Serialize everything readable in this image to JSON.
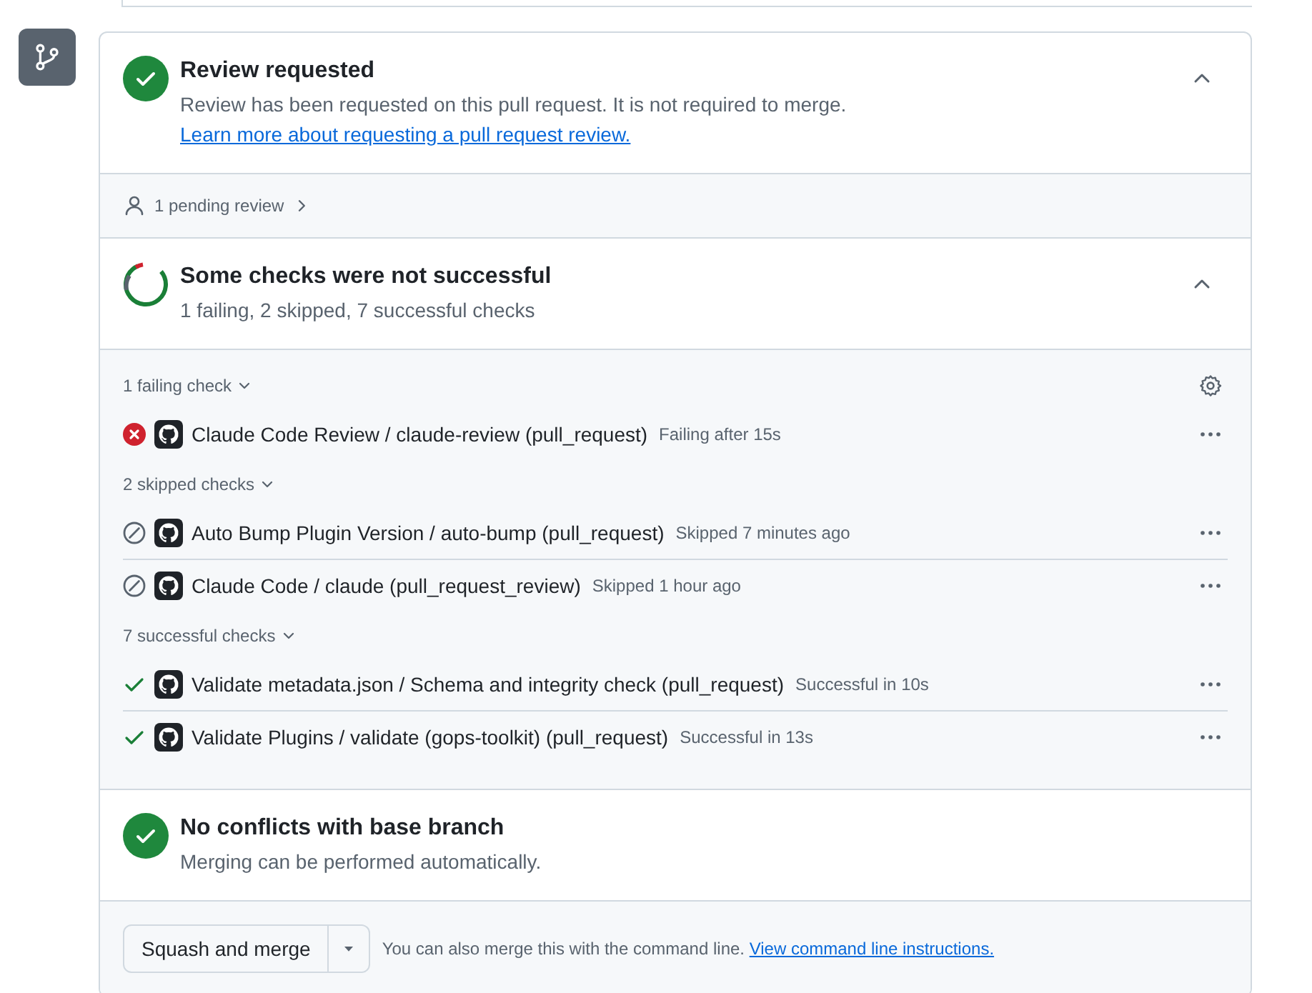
{
  "review": {
    "title": "Review requested",
    "description": "Review has been requested on this pull request. It is not required to merge. ",
    "link": "Learn more about requesting a pull request review.",
    "expanded": true
  },
  "pending": {
    "label": "1 pending review"
  },
  "checks": {
    "title": "Some checks were not successful",
    "summary": "1 failing, 2 skipped, 7 successful checks",
    "expanded": true,
    "groups": [
      {
        "label": "1 failing check",
        "expanded": true,
        "items": [
          {
            "kind": "failure",
            "name": "Claude Code Review / claude-review (pull_request)",
            "detail": "Failing after 15s"
          }
        ]
      },
      {
        "label": "2 skipped checks",
        "expanded": true,
        "items": [
          {
            "kind": "skipped",
            "name": "Auto Bump Plugin Version / auto-bump (pull_request)",
            "detail": "Skipped 7 minutes ago"
          },
          {
            "kind": "skipped",
            "name": "Claude Code / claude (pull_request_review)",
            "detail": "Skipped 1 hour ago"
          }
        ]
      },
      {
        "label": "7 successful checks",
        "expanded": true,
        "items": [
          {
            "kind": "success",
            "name": "Validate metadata.json / Schema and integrity check (pull_request)",
            "detail": "Successful in 10s"
          },
          {
            "kind": "success",
            "name": "Validate Plugins / validate (gops-toolkit) (pull_request)",
            "detail": "Successful in 13s"
          }
        ]
      }
    ]
  },
  "conflicts": {
    "title": "No conflicts with base branch",
    "description": "Merging can be performed automatically."
  },
  "merge": {
    "button": "Squash and merge",
    "hint": "You can also merge this with the command line. ",
    "link": "View command line instructions."
  }
}
